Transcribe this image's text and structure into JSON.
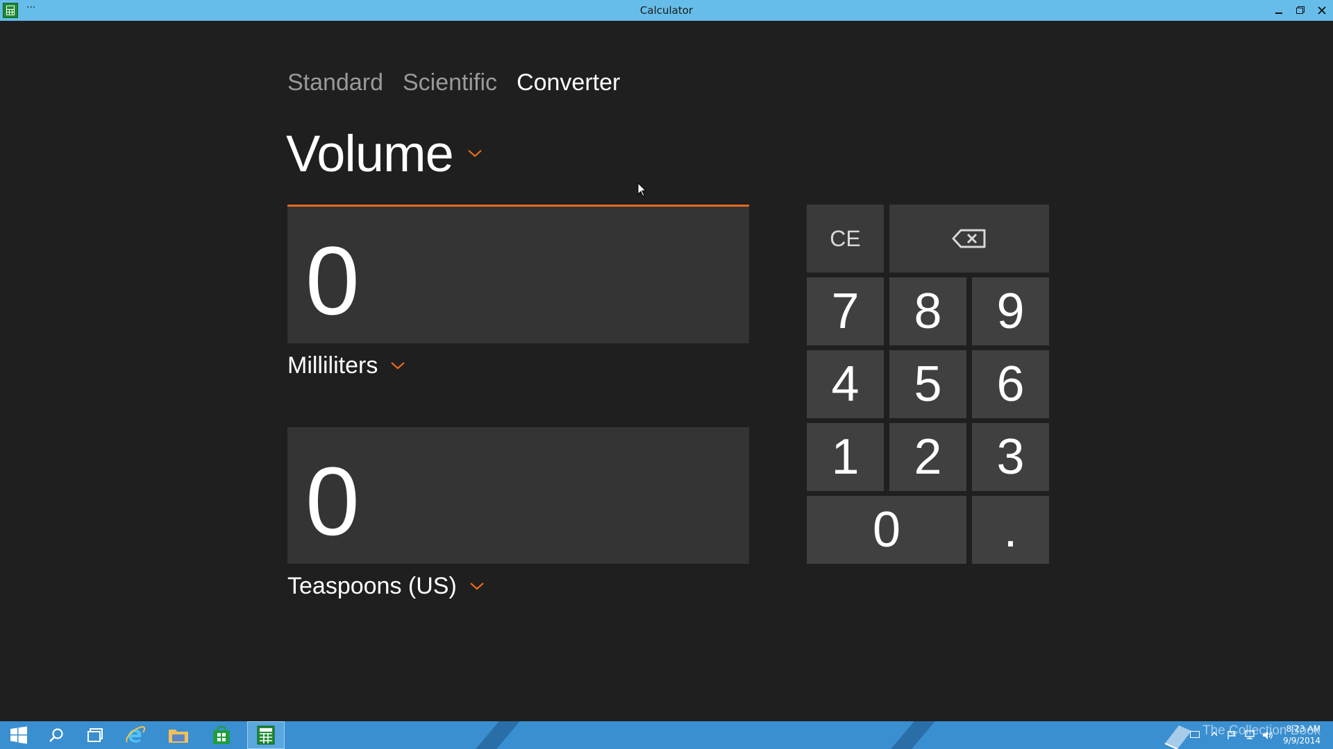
{
  "window": {
    "title": "Calculator",
    "menu_dots": "···"
  },
  "tabs": [
    {
      "label": "Standard",
      "active": false
    },
    {
      "label": "Scientific",
      "active": false
    },
    {
      "label": "Converter",
      "active": true
    }
  ],
  "category": {
    "label": "Volume",
    "icon": "chevron-down-icon"
  },
  "converter": {
    "from": {
      "value": "0",
      "unit": "Milliliters"
    },
    "to": {
      "value": "0",
      "unit": "Teaspoons (US)"
    }
  },
  "keypad": {
    "ce": "CE",
    "backspace_icon": "backspace-icon",
    "digits": [
      "7",
      "8",
      "9",
      "4",
      "5",
      "6",
      "1",
      "2",
      "3"
    ],
    "zero": "0",
    "decimal": "."
  },
  "taskbar": {
    "watermark": "The Collection Book",
    "time": "8:23 AM",
    "date": "9/9/2014"
  },
  "colors": {
    "accent": "#e86a1c",
    "titlebar": "#67bdea",
    "taskbar": "#3a8fd0",
    "background": "#1f1f1f",
    "key": "#404040",
    "display_box": "#343434"
  }
}
